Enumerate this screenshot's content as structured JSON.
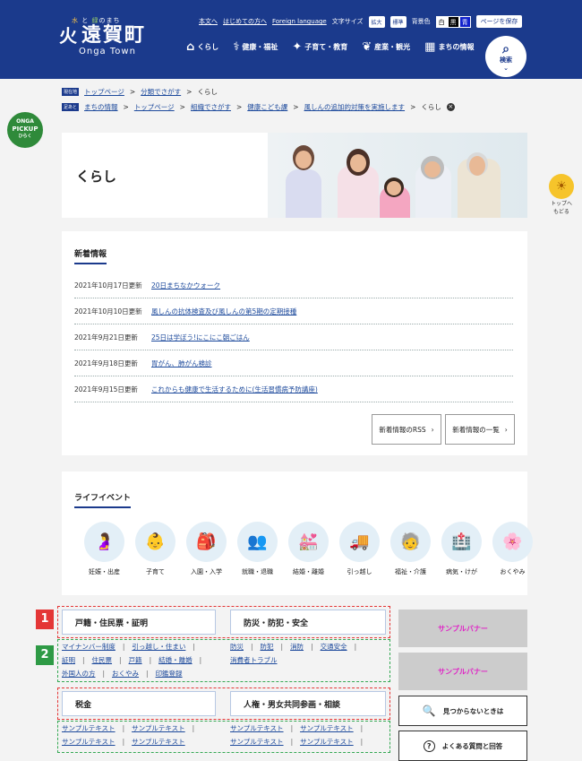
{
  "header": {
    "tagline": [
      "水",
      "と",
      "緑",
      "のまち"
    ],
    "logo_name": "遠賀町",
    "logo_en": "Onga Town",
    "util": {
      "text_version": "本文へ",
      "first_time": "はじめての方へ",
      "foreign": "Foreign language",
      "font_size_label": "文字サイズ",
      "enlarge": "拡大",
      "standard": "標準",
      "bg_color_label": "背景色",
      "bg_white": "白",
      "bg_black": "黒",
      "bg_blue": "青",
      "save_page": "ページを保存"
    },
    "nav": [
      {
        "icon": "⌂",
        "label": "くらし"
      },
      {
        "icon": "⚕",
        "label": "健康・福祉"
      },
      {
        "icon": "✦",
        "label": "子育て・教育"
      },
      {
        "icon": "❦",
        "label": "産業・観光"
      },
      {
        "icon": "▦",
        "label": "まちの情報"
      }
    ],
    "search": "検索"
  },
  "breadcrumb1": {
    "tag": "現在地",
    "items": [
      "トップページ",
      "分類でさがす",
      "くらし"
    ]
  },
  "breadcrumb2": {
    "tag": "足あと",
    "items": [
      "まちの情報",
      "トップページ",
      "組織でさがす",
      "健康こども課",
      "風しんの追加的対策を実施します",
      "くらし"
    ]
  },
  "pickup": {
    "line1": "ONGA",
    "line2": "PICKUP",
    "line3": "ひらく"
  },
  "to_top": {
    "line1": "トップへ",
    "line2": "もどる"
  },
  "page_title": "くらし",
  "news": {
    "title": "新着情報",
    "items": [
      {
        "date": "2021年10月17日更新",
        "title": "20日まちなかウォーク"
      },
      {
        "date": "2021年10月10日更新",
        "title": "風しんの抗体検査及び風しんの第5期の定期接種"
      },
      {
        "date": "2021年9月21日更新",
        "title": "25日は学ぼう!にこにこ朝ごはん"
      },
      {
        "date": "2021年9月18日更新",
        "title": "胃がん、肺がん検診"
      },
      {
        "date": "2021年9月15日更新",
        "title": "これからも健康で生活するために(生活習慣病予防講座)"
      }
    ],
    "rss": "新着情報のRSS",
    "list": "新着情報の一覧"
  },
  "life": {
    "title": "ライフイベント",
    "items": [
      {
        "icon": "🤰",
        "label": "妊娠・出産"
      },
      {
        "icon": "👶",
        "label": "子育て"
      },
      {
        "icon": "🎒",
        "label": "入園・入学"
      },
      {
        "icon": "👥",
        "label": "就職・退職"
      },
      {
        "icon": "💒",
        "label": "結婚・離婚"
      },
      {
        "icon": "🚚",
        "label": "引っ越し"
      },
      {
        "icon": "🧓",
        "label": "福祉・介護"
      },
      {
        "icon": "🏥",
        "label": "病気・けが"
      },
      {
        "icon": "🌸",
        "label": "おくやみ"
      }
    ]
  },
  "categories": {
    "badge1": "1",
    "badge2": "2",
    "cat1": "戸籍・住民票・証明",
    "cat2": "防災・防犯・安全",
    "cat3": "税金",
    "cat4": "人権・男女共同参画・相談",
    "links1_r1": [
      "マイナンバー制度",
      "引っ越し・住まい"
    ],
    "links1_r2": [
      "証明",
      "住民票",
      "戸籍",
      "結婚・離婚"
    ],
    "links1_r3": [
      "外国人の方",
      "おくやみ",
      "印鑑登録"
    ],
    "links2_r1": [
      "防災",
      "防犯",
      "消防",
      "交通安全"
    ],
    "links2_r2": [
      "消費者トラブル"
    ],
    "links3_r1": [
      "サンプルテキスト",
      "サンプルテキスト"
    ],
    "links3_r2": [
      "サンプルテキスト",
      "サンプルテキスト"
    ],
    "links4_r1": [
      "サンプルテキスト",
      "サンプルテキスト"
    ],
    "links4_r2": [
      "サンプルテキスト",
      "サンプルテキスト"
    ]
  },
  "side": {
    "banner1": "サンプルバナー",
    "banner2": "サンプルバナー",
    "notfound": "見つからないときは",
    "faq": "よくある質問と回答"
  },
  "colors": {
    "brand": "#1b3a8c",
    "red_frame": "#e43636",
    "green_frame": "#34a853"
  }
}
